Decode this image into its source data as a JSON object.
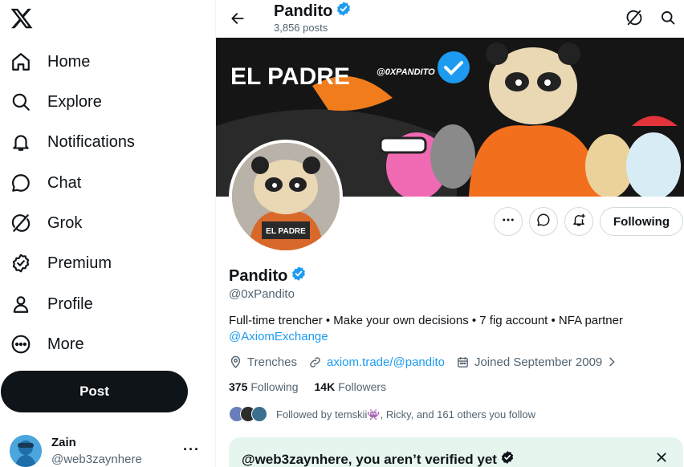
{
  "app": {
    "logo_icon": "x-logo-icon"
  },
  "sidebar": {
    "items": [
      {
        "label": "Home",
        "icon": "home-icon"
      },
      {
        "label": "Explore",
        "icon": "search-icon"
      },
      {
        "label": "Notifications",
        "icon": "bell-icon"
      },
      {
        "label": "Chat",
        "icon": "chat-bubble-icon"
      },
      {
        "label": "Grok",
        "icon": "grok-icon"
      },
      {
        "label": "Premium",
        "icon": "verified-badge-icon"
      },
      {
        "label": "Profile",
        "icon": "person-icon"
      },
      {
        "label": "More",
        "icon": "more-circle-icon"
      }
    ],
    "post_label": "Post",
    "account": {
      "name": "Zain",
      "handle": "@web3zaynhere",
      "more": "···"
    }
  },
  "header": {
    "name": "Pandito",
    "posts_count": "3,856 posts"
  },
  "profile": {
    "banner_text": "EL PADRE",
    "banner_handle": "@0XPANDITO",
    "avatar_caption": "EL PADRE",
    "name": "Pandito",
    "handle": "@0xPandito",
    "bio": "Full-time trencher • Make your own decisions • 7 fig account • NFA partner",
    "bio_mention": "@AxiomExchange",
    "location": "Trenches",
    "website": "axiom.trade/@pandito",
    "joined": "Joined September 2009",
    "following_count": "375",
    "following_label": "Following",
    "followers_count": "14K",
    "followers_label": "Followers",
    "followed_by": "Followed by temskii👾, Ricky, and 161 others you follow",
    "following_button": "Following"
  },
  "verify_card": {
    "text": "@web3zaynhere, you aren’t verified yet"
  },
  "colors": {
    "accent": "#1d9bf0",
    "text": "#0f1419",
    "muted": "#536471",
    "verify_bg": "#e6f6ee"
  }
}
